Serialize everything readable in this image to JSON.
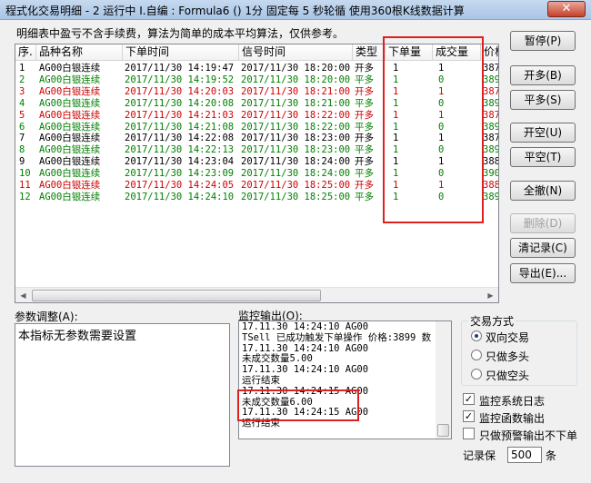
{
  "window": {
    "title": "程式化交易明细 - 2 运行中  I.自编 : Formula6 () 1分 固定每 5 秒轮循 使用360根K线数据计算",
    "close_label": "✕"
  },
  "notice": "明细表中盈亏不含手续费，算法为简单的成本平均算法，仅供参考。",
  "columns": [
    "序.",
    "品种名称",
    "下单时间",
    "信号时间",
    "类型",
    "下单量",
    "成交量",
    "价格"
  ],
  "rows": [
    {
      "idx": "1",
      "name": "AG00白银连续",
      "order_time": "2017/11/30 14:19:47",
      "signal_time": "2017/11/30 18:20:00",
      "type": "开多",
      "order_qty": "1",
      "fill_qty": "1",
      "price": "387",
      "color": "#000000"
    },
    {
      "idx": "2",
      "name": "AG00白银连续",
      "order_time": "2017/11/30 14:19:52",
      "signal_time": "2017/11/30 18:20:00",
      "type": "平多",
      "order_qty": "1",
      "fill_qty": "0",
      "price": "389",
      "color": "#008000"
    },
    {
      "idx": "3",
      "name": "AG00白银连续",
      "order_time": "2017/11/30 14:20:03",
      "signal_time": "2017/11/30 18:21:00",
      "type": "开多",
      "order_qty": "1",
      "fill_qty": "1",
      "price": "387",
      "color": "#d00000"
    },
    {
      "idx": "4",
      "name": "AG00白银连续",
      "order_time": "2017/11/30 14:20:08",
      "signal_time": "2017/11/30 18:21:00",
      "type": "平多",
      "order_qty": "1",
      "fill_qty": "0",
      "price": "389",
      "color": "#008000"
    },
    {
      "idx": "5",
      "name": "AG00白银连续",
      "order_time": "2017/11/30 14:21:03",
      "signal_time": "2017/11/30 18:22:00",
      "type": "开多",
      "order_qty": "1",
      "fill_qty": "1",
      "price": "387",
      "color": "#d00000"
    },
    {
      "idx": "6",
      "name": "AG00白银连续",
      "order_time": "2017/11/30 14:21:08",
      "signal_time": "2017/11/30 18:22:00",
      "type": "平多",
      "order_qty": "1",
      "fill_qty": "0",
      "price": "389",
      "color": "#008000"
    },
    {
      "idx": "7",
      "name": "AG00白银连续",
      "order_time": "2017/11/30 14:22:08",
      "signal_time": "2017/11/30 18:23:00",
      "type": "开多",
      "order_qty": "1",
      "fill_qty": "1",
      "price": "387",
      "color": "#000000"
    },
    {
      "idx": "8",
      "name": "AG00白银连续",
      "order_time": "2017/11/30 14:22:13",
      "signal_time": "2017/11/30 18:23:00",
      "type": "平多",
      "order_qty": "1",
      "fill_qty": "0",
      "price": "389",
      "color": "#008000"
    },
    {
      "idx": "9",
      "name": "AG00白银连续",
      "order_time": "2017/11/30 14:23:04",
      "signal_time": "2017/11/30 18:24:00",
      "type": "开多",
      "order_qty": "1",
      "fill_qty": "1",
      "price": "388",
      "color": "#000000"
    },
    {
      "idx": "10",
      "name": "AG00白银连续",
      "order_time": "2017/11/30 14:23:09",
      "signal_time": "2017/11/30 18:24:00",
      "type": "平多",
      "order_qty": "1",
      "fill_qty": "0",
      "price": "390",
      "color": "#008000"
    },
    {
      "idx": "11",
      "name": "AG00白银连续",
      "order_time": "2017/11/30 14:24:05",
      "signal_time": "2017/11/30 18:25:00",
      "type": "开多",
      "order_qty": "1",
      "fill_qty": "1",
      "price": "388",
      "color": "#d00000"
    },
    {
      "idx": "12",
      "name": "AG00白银连续",
      "order_time": "2017/11/30 14:24:10",
      "signal_time": "2017/11/30 18:25:00",
      "type": "平多",
      "order_qty": "1",
      "fill_qty": "0",
      "price": "389",
      "color": "#008000"
    }
  ],
  "buttons": {
    "pause": "暂停(P)",
    "open_long": "开多(B)",
    "close_long": "平多(S)",
    "open_short": "开空(U)",
    "close_short": "平空(T)",
    "cancel_all": "全撤(N)",
    "delete": "删除(D)",
    "clear_log": "清记录(C)",
    "export": "导出(E)..."
  },
  "params": {
    "label": "参数调整(A):",
    "text": "本指标无参数需要设置"
  },
  "monitor": {
    "label": "监控输出(O):",
    "lines": [
      "17.11.30 14:24:10 AG00",
      "TSell 已成功触发下单操作 价格:3899 数",
      "17.11.30 14:24:10 AG00",
      "未成交数量5.00",
      "17.11.30 14:24:10 AG00",
      "运行结束",
      "17.11.30 14:24:15 AG00",
      "未成交数量6.00",
      "17.11.30 14:24:15 AG00",
      "运行结束"
    ]
  },
  "trade_mode": {
    "label": "交易方式",
    "options": [
      "双向交易",
      "只做多头",
      "只做空头"
    ],
    "selected": 0
  },
  "checkboxes": [
    {
      "label": "监控系统日志",
      "checked": true
    },
    {
      "label": "监控函数输出",
      "checked": true
    },
    {
      "label": "只做预警输出不下单",
      "checked": false
    }
  ],
  "record_keep": {
    "label": "记录保",
    "value": "500",
    "unit": "条"
  }
}
